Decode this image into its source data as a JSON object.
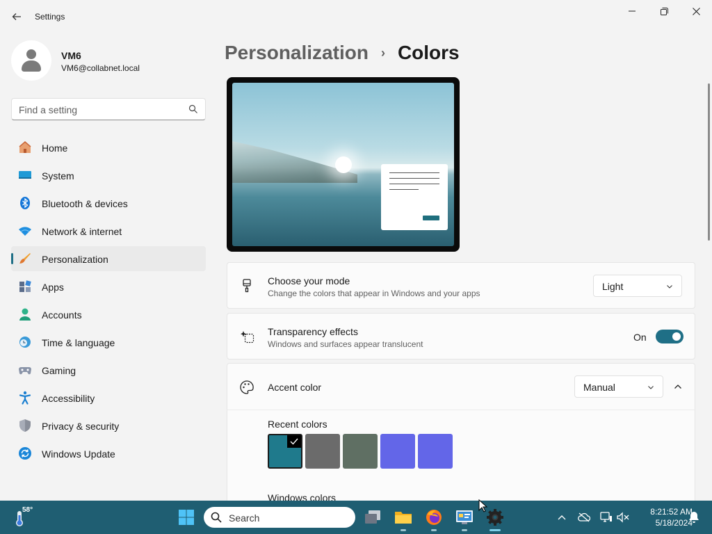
{
  "app": {
    "title": "Settings"
  },
  "window_controls": {
    "minimize": "—",
    "maximize": "❐",
    "close": "✕"
  },
  "user": {
    "name": "VM6",
    "email": "VM6@collabnet.local"
  },
  "search": {
    "placeholder": "Find a setting"
  },
  "nav": {
    "active": "Personalization",
    "items": [
      {
        "label": "Home",
        "icon": "home-icon"
      },
      {
        "label": "System",
        "icon": "system-icon"
      },
      {
        "label": "Bluetooth & devices",
        "icon": "bluetooth-icon"
      },
      {
        "label": "Network & internet",
        "icon": "wifi-icon"
      },
      {
        "label": "Personalization",
        "icon": "brush-icon"
      },
      {
        "label": "Apps",
        "icon": "apps-icon"
      },
      {
        "label": "Accounts",
        "icon": "accounts-icon"
      },
      {
        "label": "Time & language",
        "icon": "clock-globe-icon"
      },
      {
        "label": "Gaming",
        "icon": "gamepad-icon"
      },
      {
        "label": "Accessibility",
        "icon": "accessibility-icon"
      },
      {
        "label": "Privacy & security",
        "icon": "shield-icon"
      },
      {
        "label": "Windows Update",
        "icon": "update-icon"
      }
    ]
  },
  "breadcrumb": {
    "parent": "Personalization",
    "separator": "›",
    "current": "Colors"
  },
  "mode": {
    "title": "Choose your mode",
    "description": "Change the colors that appear in Windows and your apps",
    "value": "Light"
  },
  "transparency": {
    "title": "Transparency effects",
    "description": "Windows and surfaces appear translucent",
    "state": "On"
  },
  "accent": {
    "title": "Accent color",
    "value": "Manual",
    "recent_label": "Recent colors",
    "recent_colors": [
      "#1f7a8c",
      "#6b6b6b",
      "#5f6f63",
      "#6366e8",
      "#6366e8"
    ],
    "selected_index": 0,
    "windows_colors_label": "Windows colors"
  },
  "colors": {
    "accent": "#1f6f86",
    "taskbar": "#1f5e72"
  },
  "taskbar": {
    "weather_temp": "58°",
    "search_text": "Search",
    "time": "8:21:52 AM",
    "date": "5/18/2024"
  }
}
